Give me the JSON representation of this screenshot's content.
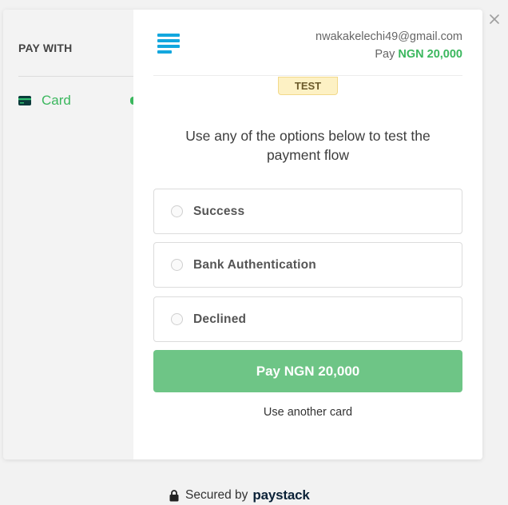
{
  "sidebar": {
    "title": "PAY WITH",
    "items": [
      {
        "label": "Card",
        "icon": "credit-card-icon",
        "active": true
      }
    ]
  },
  "header": {
    "logo": "paystack-logo",
    "email": "nwakakelechi49@gmail.com",
    "pay_label": "Pay",
    "amount": "NGN 20,000"
  },
  "badge": {
    "label": "TEST"
  },
  "instructions": "Use any of the options below to test the payment flow",
  "options": [
    {
      "label": "Success",
      "selected": false
    },
    {
      "label": "Bank Authentication",
      "selected": false
    },
    {
      "label": "Declined",
      "selected": false
    }
  ],
  "pay_button": {
    "label": "Pay NGN 20,000"
  },
  "alt_link": {
    "label": "Use another card"
  },
  "footer": {
    "secured_text": "Secured by",
    "brand": "paystack",
    "icon": "lock-icon"
  },
  "colors": {
    "accent_green": "#3bb75e",
    "pay_button_green": "#6ec586",
    "logo_blue": "#13a7de",
    "test_badge_bg": "#fdf1c4",
    "brand_navy": "#0b2238"
  }
}
